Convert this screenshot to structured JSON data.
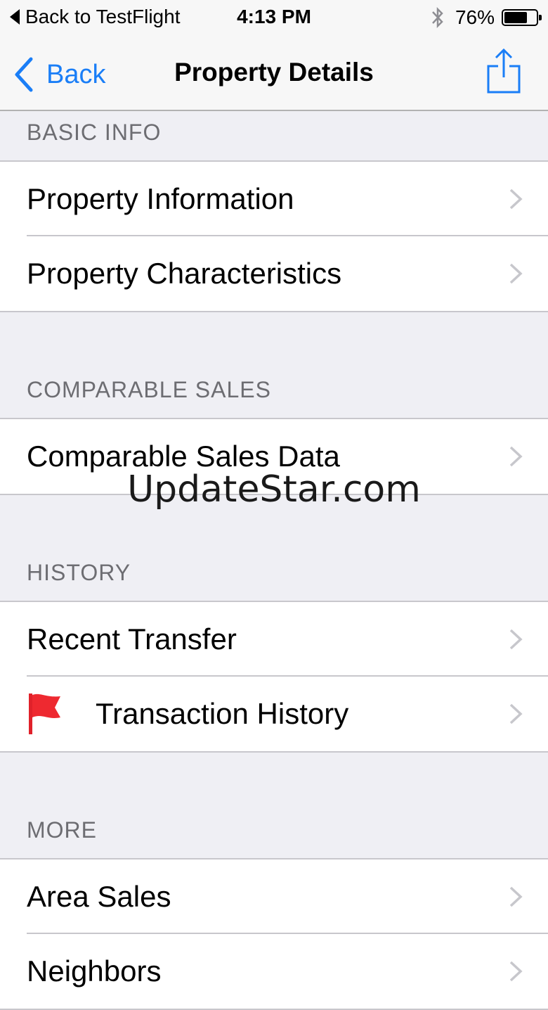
{
  "status_bar": {
    "back_label": "Back to TestFlight",
    "time": "4:13 PM",
    "battery_percent_label": "76%",
    "battery_level": 0.76
  },
  "nav": {
    "back_label": "Back",
    "title": "Property Details",
    "accent_color": "#1a7ef7"
  },
  "sections": [
    {
      "header": "BASIC INFO",
      "items": [
        "Property Information",
        "Property Characteristics"
      ]
    },
    {
      "header": "COMPARABLE SALES",
      "items": [
        "Comparable Sales Data"
      ]
    },
    {
      "header": "HISTORY",
      "items": [
        "Recent Transfer",
        "Transaction History"
      ]
    },
    {
      "header": "MORE",
      "items": [
        "Area Sales",
        "Neighbors"
      ]
    }
  ],
  "icons": {
    "transaction_history": "red-flag-icon",
    "row_accessory": "chevron-right-icon",
    "share": "share-icon"
  },
  "watermark": "UpdateStar.com"
}
